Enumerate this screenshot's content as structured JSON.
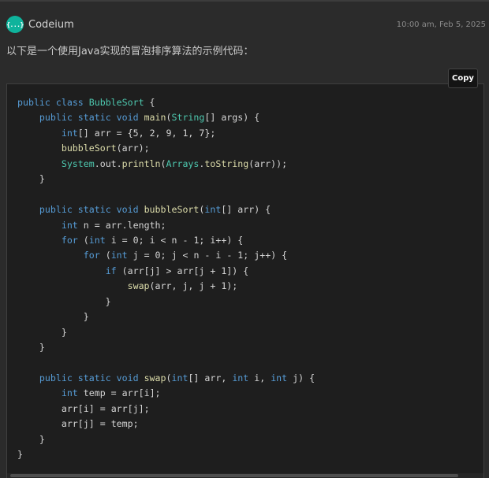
{
  "header": {
    "app_name": "Codeium",
    "avatar_icon": "{...}",
    "timestamp": "10:00 am, Feb 5, 2025"
  },
  "message": {
    "intro": "以下是一个使用Java实现的冒泡排序算法的示例代码："
  },
  "code_block": {
    "copy_label": "Copy",
    "language": "java",
    "lines": [
      "public class BubbleSort {",
      "    public static void main(String[] args) {",
      "        int[] arr = {5, 2, 9, 1, 7};",
      "        bubbleSort(arr);",
      "        System.out.println(Arrays.toString(arr));",
      "    }",
      "",
      "    public static void bubbleSort(int[] arr) {",
      "        int n = arr.length;",
      "        for (int i = 0; i < n - 1; i++) {",
      "            for (int j = 0; j < n - i - 1; j++) {",
      "                if (arr[j] > arr[j + 1]) {",
      "                    swap(arr, j, j + 1);",
      "                }",
      "            }",
      "        }",
      "    }",
      "",
      "    public static void swap(int[] arr, int i, int j) {",
      "        int temp = arr[i];",
      "        arr[i] = arr[j];",
      "        arr[j] = temp;",
      "    }",
      "}"
    ]
  },
  "colors": {
    "background": "#2b2b2b",
    "code_background": "#1e1e1e",
    "avatar": "#0fb39c",
    "keyword": "#569cd6",
    "type": "#4ec9b0",
    "function": "#dcdcaa",
    "plain": "#d4d4d4"
  }
}
